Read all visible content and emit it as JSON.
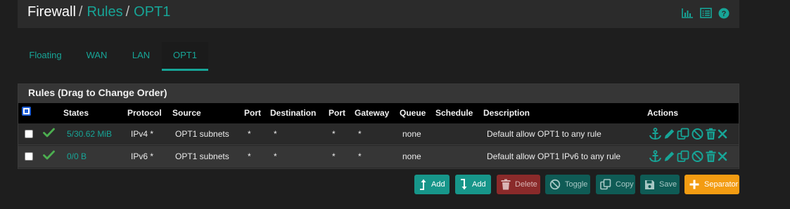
{
  "breadcrumb": {
    "part1": "Firewall",
    "sep1": "/",
    "part2": "Rules",
    "sep2": "/",
    "part3": "OPT1"
  },
  "header_icons": [
    "chart-icon",
    "list-icon",
    "help-icon"
  ],
  "tabs": [
    {
      "label": "Floating",
      "active": false
    },
    {
      "label": "WAN",
      "active": false
    },
    {
      "label": "LAN",
      "active": false
    },
    {
      "label": "OPT1",
      "active": true
    }
  ],
  "panel": {
    "title": "Rules (Drag to Change Order)"
  },
  "table": {
    "headers": {
      "states": "States",
      "protocol": "Protocol",
      "source": "Source",
      "port": "Port",
      "destination": "Destination",
      "dport": "Port",
      "gateway": "Gateway",
      "queue": "Queue",
      "schedule": "Schedule",
      "description": "Description",
      "actions": "Actions"
    },
    "rows": [
      {
        "states": "5/30.62 MiB",
        "protocol": "IPv4 *",
        "source": "OPT1 subnets",
        "port": "*",
        "destination": "*",
        "dport": "*",
        "gateway": "*",
        "queue": "none",
        "schedule": "",
        "description": "Default allow OPT1 to any rule"
      },
      {
        "states": "0/0 B",
        "protocol": "IPv6 *",
        "source": "OPT1 subnets",
        "port": "*",
        "destination": "*",
        "dport": "*",
        "gateway": "*",
        "queue": "none",
        "schedule": "",
        "description": "Default allow OPT1 IPv6 to any rule"
      }
    ]
  },
  "buttons": {
    "add_top": "Add",
    "add_bottom": "Add",
    "delete": "Delete",
    "toggle": "Toggle",
    "copy": "Copy",
    "save": "Save",
    "separator": "Separator"
  },
  "colors": {
    "accent": "#17a597",
    "danger": "#8a2a2a",
    "warning": "#f39c12",
    "check": "#4caf50"
  }
}
